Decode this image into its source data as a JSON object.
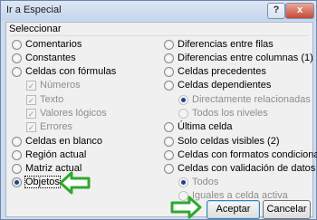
{
  "window": {
    "title": "Ir a Especial",
    "help": "?",
    "close": "x"
  },
  "group_label": "Seleccionar",
  "left_options": [
    {
      "label": "Comentarios"
    },
    {
      "label": "Constantes"
    },
    {
      "label": "Celdas con fórmulas"
    },
    {
      "label": "Números"
    },
    {
      "label": "Texto"
    },
    {
      "label": "Valores lógicos"
    },
    {
      "label": "Errores"
    },
    {
      "label": "Celdas en blanco"
    },
    {
      "label": "Región actual"
    },
    {
      "label": "Matriz actual"
    },
    {
      "label": "Objetos"
    }
  ],
  "right_options": [
    {
      "label": "Diferencias entre filas"
    },
    {
      "label": "Diferencias entre columnas (1)"
    },
    {
      "label": "Celdas precedentes"
    },
    {
      "label": "Celdas dependientes"
    },
    {
      "label": "Directamente relacionadas"
    },
    {
      "label": "Todos los niveles"
    },
    {
      "label": "Última celda"
    },
    {
      "label": "Solo celdas visibles (2)"
    },
    {
      "label": "Celdas con formatos condicionales"
    },
    {
      "label": "Celdas con validación de datos"
    },
    {
      "label": "Todos"
    },
    {
      "label": "Iguales a celda activa"
    }
  ],
  "buttons": {
    "ok": "Aceptar",
    "cancel": "Cancelar"
  },
  "colors": {
    "arrow": "#2fa82f",
    "title_bar": "#c9d8ee",
    "close": "#c9513d"
  }
}
